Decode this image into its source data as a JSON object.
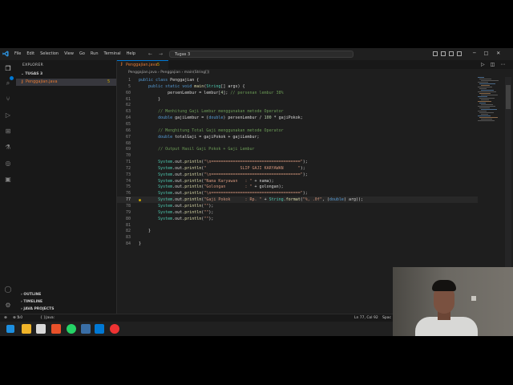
{
  "window": {
    "menu": [
      "File",
      "Edit",
      "Selection",
      "View",
      "Go",
      "Run",
      "Terminal",
      "Help"
    ],
    "search_text": "Tugas 3"
  },
  "sidebar": {
    "header": "EXPLORER",
    "folder": "TUGAS 3",
    "file": {
      "icon": "J",
      "name": "Penggajian.java",
      "problems": "5"
    },
    "sections": [
      "OUTLINE",
      "TIMELINE",
      "JAVA PROJECTS"
    ]
  },
  "editor": {
    "tab": {
      "icon": "J",
      "name": "Penggajian.java",
      "problems": "5"
    },
    "breadcrumb": [
      "Penggajian.java",
      "Penggajian",
      "main(String[])"
    ],
    "sticky": [
      {
        "ln": "1",
        "text": "public class Penggajian {"
      },
      {
        "ln": "5",
        "text": "    public static void main(String[] args) {"
      }
    ],
    "lines": [
      {
        "ln": "60",
        "text": "            persenLembur = lembur[4]; // persenan lembur 38%"
      },
      {
        "ln": "61",
        "text": "        }"
      },
      {
        "ln": "62",
        "text": ""
      },
      {
        "ln": "63",
        "text": "        // Menhitung Gaji Lembur menggunakan metode Operator"
      },
      {
        "ln": "64",
        "text": "        double gajiLembur = (double) persenLembur / 100 * gajiPokok;"
      },
      {
        "ln": "65",
        "text": ""
      },
      {
        "ln": "66",
        "text": "        // Menghitung Total Gaji menggunakan metode Operator"
      },
      {
        "ln": "67",
        "text": "        double totalGaji = gajiPokok + gajiLembur;"
      },
      {
        "ln": "68",
        "text": ""
      },
      {
        "ln": "69",
        "text": "        // Output Hasil Gaji Pokok + Gaji Lembur"
      },
      {
        "ln": "70",
        "text": ""
      },
      {
        "ln": "71",
        "text": "        System.out.println(\"\\n=====================================\");"
      },
      {
        "ln": "72",
        "text": "        System.out.println(\"              SLIP GAJI KARYAWAN      \");"
      },
      {
        "ln": "73",
        "text": "        System.out.println(\"\\n=====================================\");"
      },
      {
        "ln": "74",
        "text": "        System.out.println(\"Nama Karyawan   : \" + nama);"
      },
      {
        "ln": "75",
        "text": "        System.out.println(\"Golongan        : \" + golongan);"
      },
      {
        "ln": "76",
        "text": "        System.out.println(\"\\n=====================================\");"
      },
      {
        "ln": "77",
        "text": "        System.out.println(\"Gaji Pokok      : Rp. \" + String.format(\"%, .0f\", (double) arg));"
      },
      {
        "ln": "78",
        "text": "        System.out.println(\"\");"
      },
      {
        "ln": "79",
        "text": "        System.out.println(\"\");"
      },
      {
        "ln": "80",
        "text": "        System.out.println(\"\");"
      },
      {
        "ln": "81",
        "text": ""
      },
      {
        "ln": "82",
        "text": "    }"
      },
      {
        "ln": "83",
        "text": ""
      },
      {
        "ln": "84",
        "text": "}"
      }
    ],
    "active_line": "77"
  },
  "statusbar": {
    "errors": "5",
    "warnings": "0",
    "java": "Java: Ready",
    "position": "Ln 77, Col 92",
    "spaces": "Spac"
  },
  "colors": {
    "accent": "#0078d4",
    "editor_bg": "#1e1e1e",
    "java_orange": "#e37933",
    "warning": "#cca700"
  }
}
